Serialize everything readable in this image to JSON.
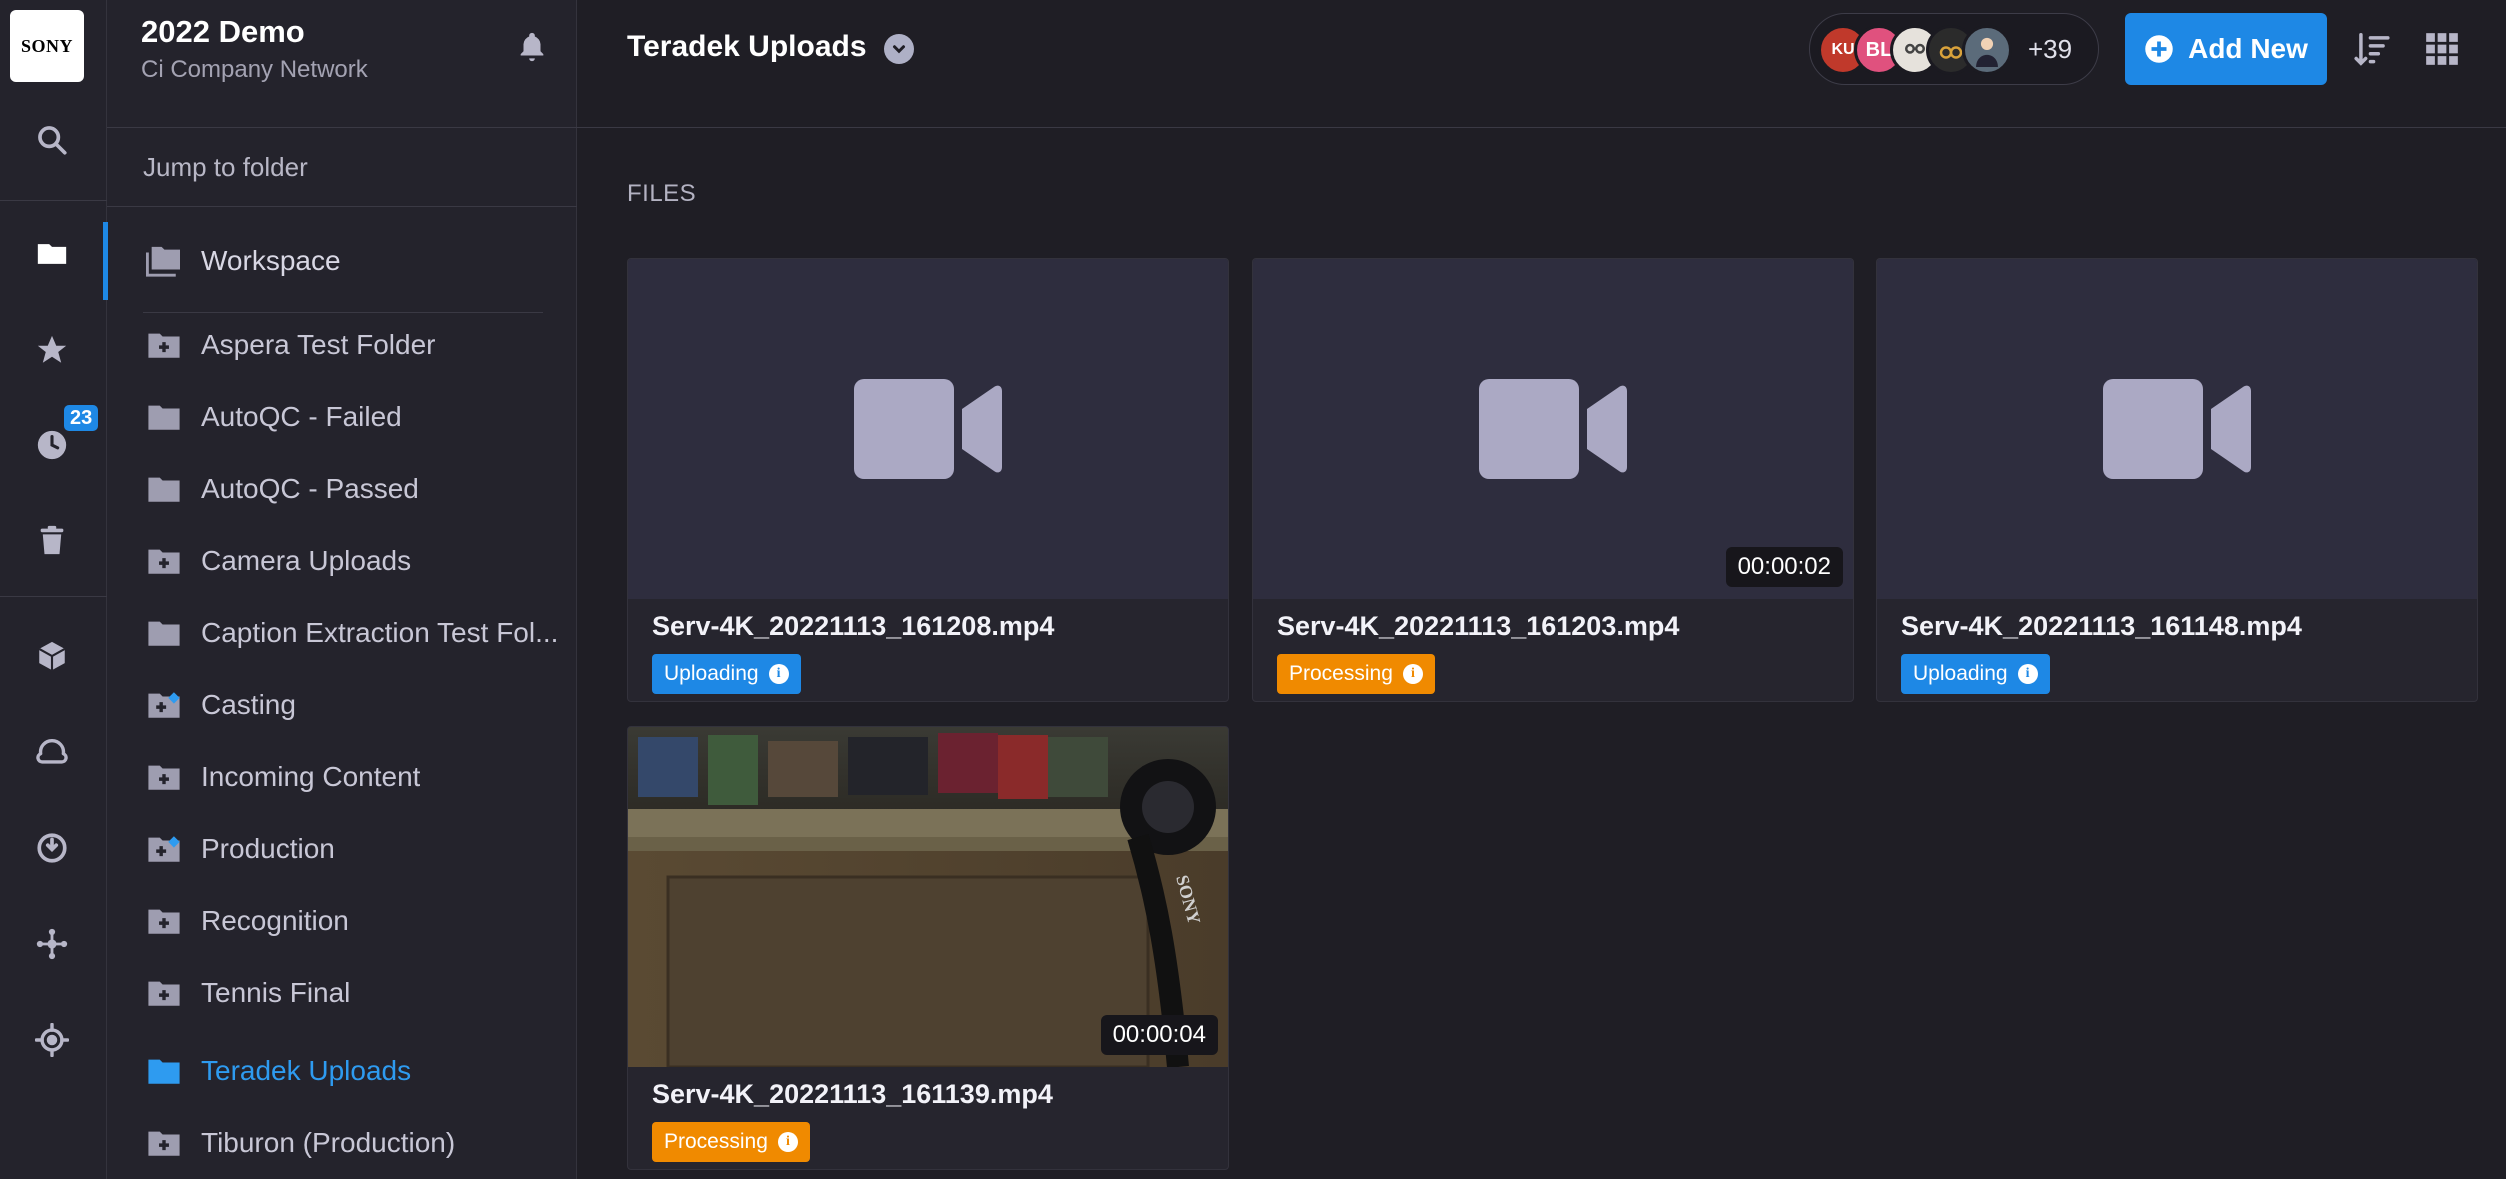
{
  "rail": {
    "logo": "SONY",
    "recent_badge": "23",
    "items": [
      "search-icon",
      "folder-icon",
      "star-icon",
      "clock-icon",
      "trash-icon",
      "cube-icon",
      "cloud-icon",
      "power-icon",
      "network-icon",
      "crosshair-icon"
    ]
  },
  "panel": {
    "title": "2022 Demo",
    "subtitle": "Ci Company Network",
    "jump_placeholder": "Jump to folder",
    "workspace_label": "Workspace",
    "folders": [
      {
        "label": "Aspera Test Folder",
        "icon": "folder-plus-icon"
      },
      {
        "label": "AutoQC - Failed",
        "icon": "folder-icon"
      },
      {
        "label": "AutoQC - Passed",
        "icon": "folder-icon"
      },
      {
        "label": "Camera Uploads",
        "icon": "folder-plus-icon"
      },
      {
        "label": "Caption Extraction Test Fol...",
        "icon": "folder-icon"
      },
      {
        "label": "Casting",
        "icon": "folder-shared-icon"
      },
      {
        "label": "Incoming Content",
        "icon": "folder-plus-icon"
      },
      {
        "label": "Production",
        "icon": "folder-shared-icon"
      },
      {
        "label": "Recognition",
        "icon": "folder-plus-icon"
      },
      {
        "label": "Tennis Final",
        "icon": "folder-plus-icon"
      },
      {
        "label": "Teradek Uploads",
        "icon": "folder-icon"
      },
      {
        "label": "Tiburon (Production)",
        "icon": "folder-plus-icon"
      }
    ],
    "active_folder": "Teradek Uploads"
  },
  "header": {
    "title": "Teradek Uploads",
    "avatars": [
      "KU",
      "BL",
      "",
      "",
      ""
    ],
    "avatars_more": "+39",
    "add_new_label": "Add New"
  },
  "files": {
    "section_label": "FILES",
    "items": [
      {
        "name": "Serv-4K_20221113_161208.mp4",
        "status": "Uploading",
        "duration": ""
      },
      {
        "name": "Serv-4K_20221113_161203.mp4",
        "status": "Processing",
        "duration": "00:00:02"
      },
      {
        "name": "Serv-4K_20221113_161148.mp4",
        "status": "Uploading",
        "duration": ""
      },
      {
        "name": "Serv-4K_20221113_161139.mp4",
        "status": "Processing",
        "duration": "00:00:04"
      }
    ]
  },
  "colors": {
    "accent": "#1e88e5",
    "uploading": "#1e88e5",
    "processing": "#f08a00",
    "background": "#1f1e25",
    "panel": "#24232c"
  }
}
